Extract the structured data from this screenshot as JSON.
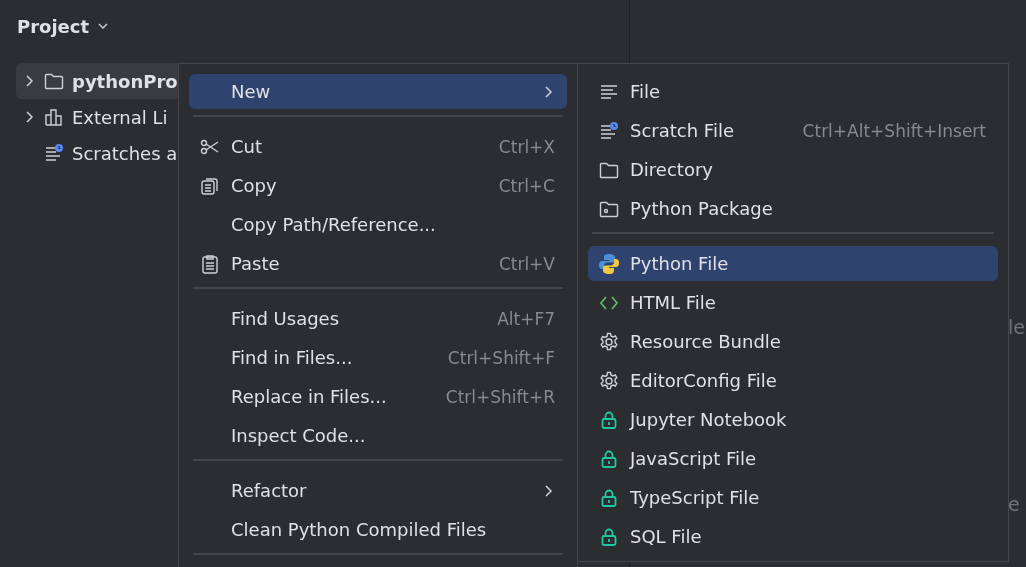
{
  "project_panel": {
    "title": "Project",
    "tree": [
      {
        "label": "pythonPro",
        "kind": "folder",
        "selected": true,
        "bold": true,
        "expandable": true
      },
      {
        "label": "External Li",
        "kind": "library",
        "selected": false,
        "bold": false,
        "expandable": true
      },
      {
        "label": "Scratches a",
        "kind": "scratch",
        "selected": false,
        "bold": false,
        "expandable": false
      }
    ]
  },
  "editor": {
    "hints": [
      "le",
      "e"
    ]
  },
  "context_menu": {
    "items": [
      {
        "kind": "plain",
        "label": "New",
        "has_submenu": true,
        "selected": true
      },
      {
        "kind": "separator"
      },
      {
        "kind": "scissors",
        "label": "Cut",
        "shortcut": "Ctrl+X",
        "selected": false
      },
      {
        "kind": "copies",
        "label": "Copy",
        "shortcut": "Ctrl+C",
        "selected": false
      },
      {
        "kind": "plain",
        "label": "Copy Path/Reference...",
        "selected": false
      },
      {
        "kind": "clipboard",
        "label": "Paste",
        "shortcut": "Ctrl+V",
        "selected": false
      },
      {
        "kind": "separator"
      },
      {
        "kind": "plain",
        "label": "Find Usages",
        "shortcut": "Alt+F7",
        "selected": false
      },
      {
        "kind": "plain",
        "label": "Find in Files...",
        "shortcut": "Ctrl+Shift+F",
        "selected": false
      },
      {
        "kind": "plain",
        "label": "Replace in Files...",
        "shortcut": "Ctrl+Shift+R",
        "selected": false
      },
      {
        "kind": "plain",
        "label": "Inspect Code...",
        "selected": false
      },
      {
        "kind": "separator"
      },
      {
        "kind": "plain",
        "label": "Refactor",
        "has_submenu": true,
        "selected": false
      },
      {
        "kind": "plain",
        "label": "Clean Python Compiled Files",
        "selected": false
      },
      {
        "kind": "separator"
      }
    ]
  },
  "new_submenu": {
    "items": [
      {
        "kind": "lines",
        "label": "File",
        "selected": false
      },
      {
        "kind": "scratch",
        "label": "Scratch File",
        "shortcut": "Ctrl+Alt+Shift+Insert",
        "selected": false
      },
      {
        "kind": "folder",
        "label": "Directory",
        "selected": false
      },
      {
        "kind": "package",
        "label": "Python Package",
        "selected": false
      },
      {
        "kind": "separator"
      },
      {
        "kind": "python",
        "label": "Python File",
        "selected": true
      },
      {
        "kind": "code",
        "label": "HTML File",
        "selected": false
      },
      {
        "kind": "gear",
        "label": "Resource Bundle",
        "selected": false
      },
      {
        "kind": "gear",
        "label": "EditorConfig File",
        "selected": false
      },
      {
        "kind": "lock",
        "label": "Jupyter Notebook",
        "selected": false
      },
      {
        "kind": "lock",
        "label": "JavaScript File",
        "selected": false
      },
      {
        "kind": "lock",
        "label": "TypeScript File",
        "selected": false
      },
      {
        "kind": "lock",
        "label": "SQL File",
        "selected": false
      }
    ]
  }
}
